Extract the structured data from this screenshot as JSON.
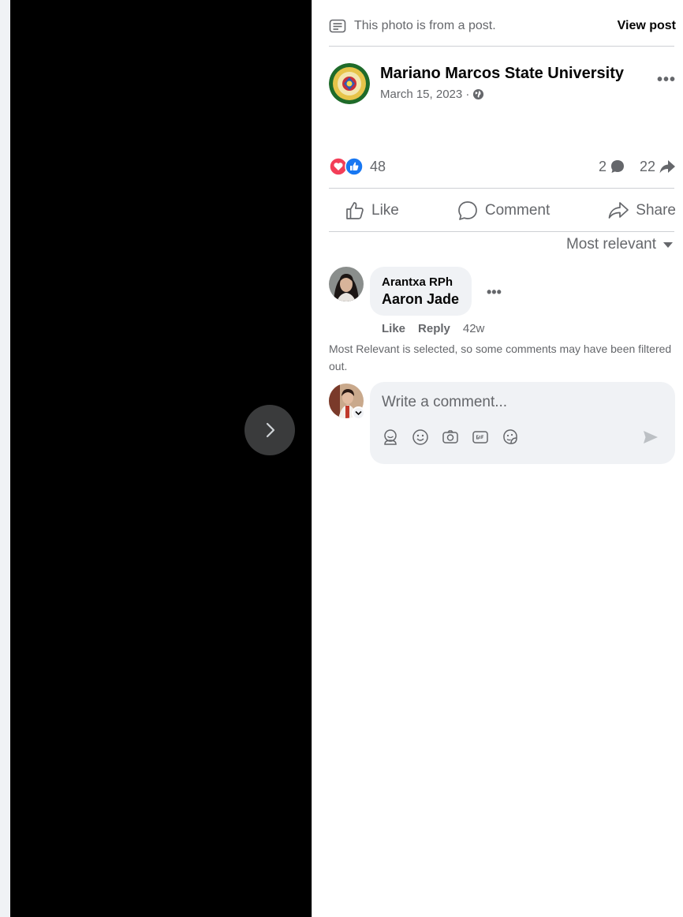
{
  "banner": {
    "text": "This photo is from a post.",
    "view_post": "View post"
  },
  "post": {
    "author": "Mariano Marcos State University",
    "date": "March 15, 2023 ·",
    "more": "•••"
  },
  "reactions": {
    "count": "48",
    "comments": "2",
    "shares": "22"
  },
  "actions": {
    "like": "Like",
    "comment": "Comment",
    "share": "Share"
  },
  "sort": {
    "label": "Most relevant"
  },
  "comments": [
    {
      "name": "Arantxa RPh",
      "text": "Aaron Jade",
      "like": "Like",
      "reply": "Reply",
      "time": "42w",
      "more": "•••"
    }
  ],
  "filter_note": "Most Relevant is selected, so some comments may have been filtered out.",
  "composer": {
    "placeholder": "Write a comment..."
  },
  "colors": {
    "accent": "#1877f2",
    "love": "#f33e58",
    "muted": "#65676b",
    "viewer_bg": "#000000"
  },
  "icons": [
    "chevron-right-icon",
    "post-icon",
    "globe-icon",
    "love-reaction-icon",
    "like-reaction-icon",
    "comment-bubble-icon",
    "share-arrow-icon",
    "thumb-up-icon",
    "comment-icon",
    "share-icon",
    "caret-down-icon",
    "avatar-sticker-icon",
    "emoji-icon",
    "camera-icon",
    "gif-icon",
    "sticker-icon",
    "send-icon"
  ]
}
